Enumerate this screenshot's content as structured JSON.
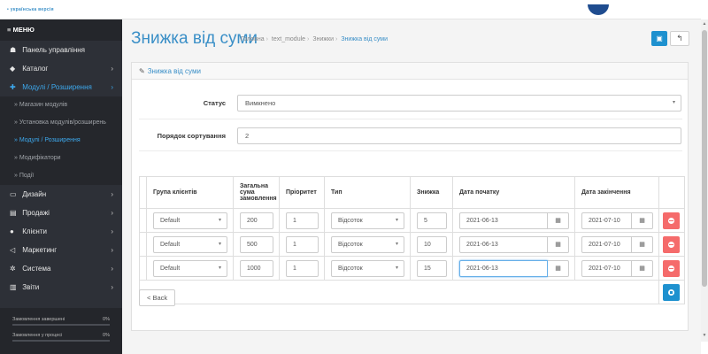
{
  "topbar": {
    "brand": "• українська версія"
  },
  "sidebar": {
    "menu_title": "≡ МЕНЮ",
    "items": [
      {
        "icon": "dashboard-icon",
        "glyph": "☗",
        "label": "Панель управління",
        "chevron": ""
      },
      {
        "icon": "tag-icon",
        "glyph": "◆",
        "label": "Каталог",
        "chevron": "›"
      },
      {
        "icon": "puzzle-icon",
        "glyph": "✚",
        "label": "Модулі / Розширення",
        "chevron": "›"
      }
    ],
    "submenu": [
      "» Магазин модулів",
      "» Установка модулів/розширень",
      "» Модулі / Розширення",
      "» Модифікатори",
      "» Події"
    ],
    "items2": [
      {
        "icon": "desktop-icon",
        "glyph": "▭",
        "label": "Дизайн",
        "chevron": "›"
      },
      {
        "icon": "cart-icon",
        "glyph": "▤",
        "label": "Продажі",
        "chevron": "›"
      },
      {
        "icon": "user-icon",
        "glyph": "●",
        "label": "Клієнти",
        "chevron": "›"
      },
      {
        "icon": "share-icon",
        "glyph": "◁",
        "label": "Маркетинг",
        "chevron": "›"
      },
      {
        "icon": "cog-icon",
        "glyph": "✲",
        "label": "Система",
        "chevron": "›"
      },
      {
        "icon": "bar-chart-icon",
        "glyph": "▥",
        "label": "Звіти",
        "chevron": "›"
      }
    ],
    "progress": [
      {
        "label": "Замовлення завершені",
        "value": "0%",
        "fraction": 0
      },
      {
        "label": "Замовлення у процесі",
        "value": "0%",
        "fraction": 0
      }
    ]
  },
  "header": {
    "title": "Знижка від суми",
    "breadcrumbs": [
      "Головна",
      "text_module",
      "Знижки",
      "Знижка від суми"
    ],
    "save_icon": "save-icon",
    "back_icon": "reply-icon"
  },
  "panel": {
    "title": "Знижка від суми",
    "status_label": "Статус",
    "status_value": "Вимкнено",
    "sort_label": "Порядок сортування",
    "sort_value": "2"
  },
  "table": {
    "headers": [
      "Група клієнтів",
      "Загальна сума замовлення",
      "Пріоритет",
      "Тип",
      "Знижка",
      "Дата початку",
      "Дата закінчення"
    ],
    "rows": [
      {
        "group": "Default",
        "total": "200",
        "priority": "1",
        "type": "Відсоток",
        "discount": "5",
        "start": "2021-06-13",
        "end": "2021-07-10"
      },
      {
        "group": "Default",
        "total": "500",
        "priority": "1",
        "type": "Відсоток",
        "discount": "10",
        "start": "2021-06-13",
        "end": "2021-07-10"
      },
      {
        "group": "Default",
        "total": "1000",
        "priority": "1",
        "type": "Відсоток",
        "discount": "15",
        "start": "2021-06-13",
        "end": "2021-07-10"
      }
    ]
  },
  "back_button": "< Back",
  "colors": {
    "accent": "#3a8fc7",
    "primary_button": "#1e91cf",
    "danger_button": "#f56b6b",
    "sidebar": "#2d3037"
  }
}
